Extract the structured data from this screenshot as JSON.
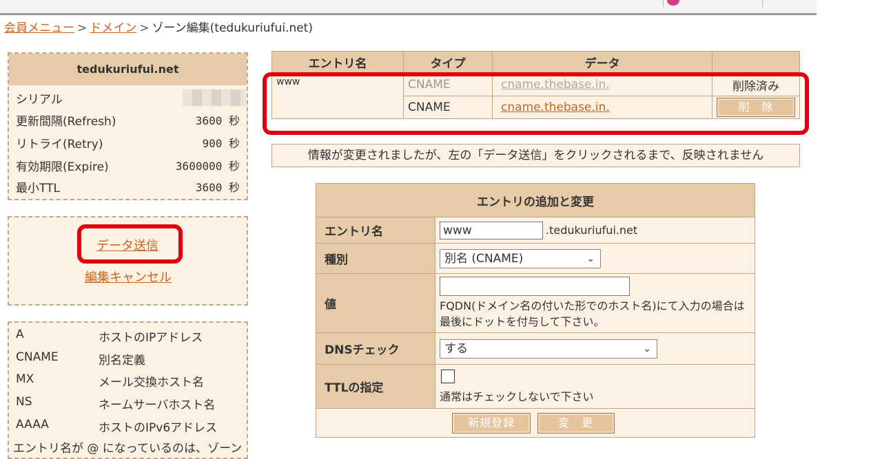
{
  "breadcrumb": {
    "item1": "会員メニュー",
    "item2": "ドメイン",
    "current": "ゾーン編集(tedukuriufui.net)",
    "sep": ">"
  },
  "zone": {
    "name": "tedukuriufui.net",
    "rows": [
      {
        "key": "シリアル",
        "value": ""
      },
      {
        "key": "更新間隔(Refresh)",
        "value": "3600 秒"
      },
      {
        "key": "リトライ(Retry)",
        "value": "900 秒"
      },
      {
        "key": "有効期限(Expire)",
        "value": "3600000 秒"
      },
      {
        "key": "最小TTL",
        "value": "3600 秒"
      }
    ]
  },
  "actions": {
    "submit": "データ送信",
    "cancel": "編集キャンセル"
  },
  "legend": [
    {
      "type": "A",
      "desc": "ホストのIPアドレス"
    },
    {
      "type": "CNAME",
      "desc": "別名定義"
    },
    {
      "type": "MX",
      "desc": "メール交換ホスト名"
    },
    {
      "type": "NS",
      "desc": "ネームサーバホスト名"
    },
    {
      "type": "AAAA",
      "desc": "ホストのIPv6アドレス"
    }
  ],
  "legend_note": "エントリ名が @ になっているのは、ゾーン",
  "records": {
    "headers": {
      "entry": "エントリ名",
      "type": "タイプ",
      "data": "データ",
      "op": ""
    },
    "entry": "www",
    "rows": [
      {
        "type": "CNAME",
        "data": "cname.thebase.in.",
        "status": "削除済み"
      },
      {
        "type": "CNAME",
        "data": "cname.thebase.in.",
        "action": "削　除"
      }
    ]
  },
  "info_message": "情報が変更されましたが、左の「データ送信」をクリックされるまで、反映されません",
  "form": {
    "title": "エントリの追加と変更",
    "entry_label": "エントリ名",
    "entry_value": "www",
    "entry_suffix": ".tedukuriufui.net",
    "kind_label": "種別",
    "kind_value": "別名 (CNAME)",
    "value_label": "値",
    "value_value": "",
    "value_hint": "FQDN(ドメイン名の付いた形でのホスト名)にて入力の場合は最後にドットを付与して下さい。",
    "dns_label": "DNSチェック",
    "dns_value": "する",
    "ttl_label": "TTLの指定",
    "ttl_hint": "通常はチェックしないで下さい",
    "register_button": "新規登録",
    "change_button": "変　更"
  },
  "colors": {
    "accent": "#c8641e",
    "highlight": "#e1000b",
    "header_bg": "#e6cba9",
    "cell_bg": "#fdf1e3"
  }
}
